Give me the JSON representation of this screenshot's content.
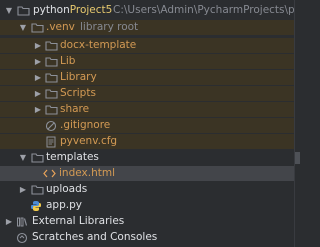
{
  "project": {
    "name": "python",
    "name_highlight": "Project5",
    "path": "C:\\Users\\Admin\\PycharmProjects\\pythonPro"
  },
  "venv": {
    "name": ".venv",
    "tag": "library root"
  },
  "venv_children": [
    {
      "label": "docx-template"
    },
    {
      "label": "Lib"
    },
    {
      "label": "Library"
    },
    {
      "label": "Scripts"
    },
    {
      "label": "share"
    }
  ],
  "venv_files": [
    {
      "label": ".gitignore",
      "icon": "gitignore-icon"
    },
    {
      "label": "pyvenv.cfg",
      "icon": "config-file-icon"
    }
  ],
  "templates": {
    "label": "templates"
  },
  "index_file": {
    "label": "index.html"
  },
  "uploads": {
    "label": "uploads"
  },
  "app_file": {
    "label": "app.py"
  },
  "external_libraries": {
    "label": "External Libraries"
  },
  "scratches": {
    "label": "Scratches and Consoles"
  },
  "colors": {
    "background": "#2b2d30",
    "excluded_bg": "#3b3424",
    "selected_bg": "#43454a",
    "orange_text": "#d39a54",
    "folder": "#8c9099"
  }
}
